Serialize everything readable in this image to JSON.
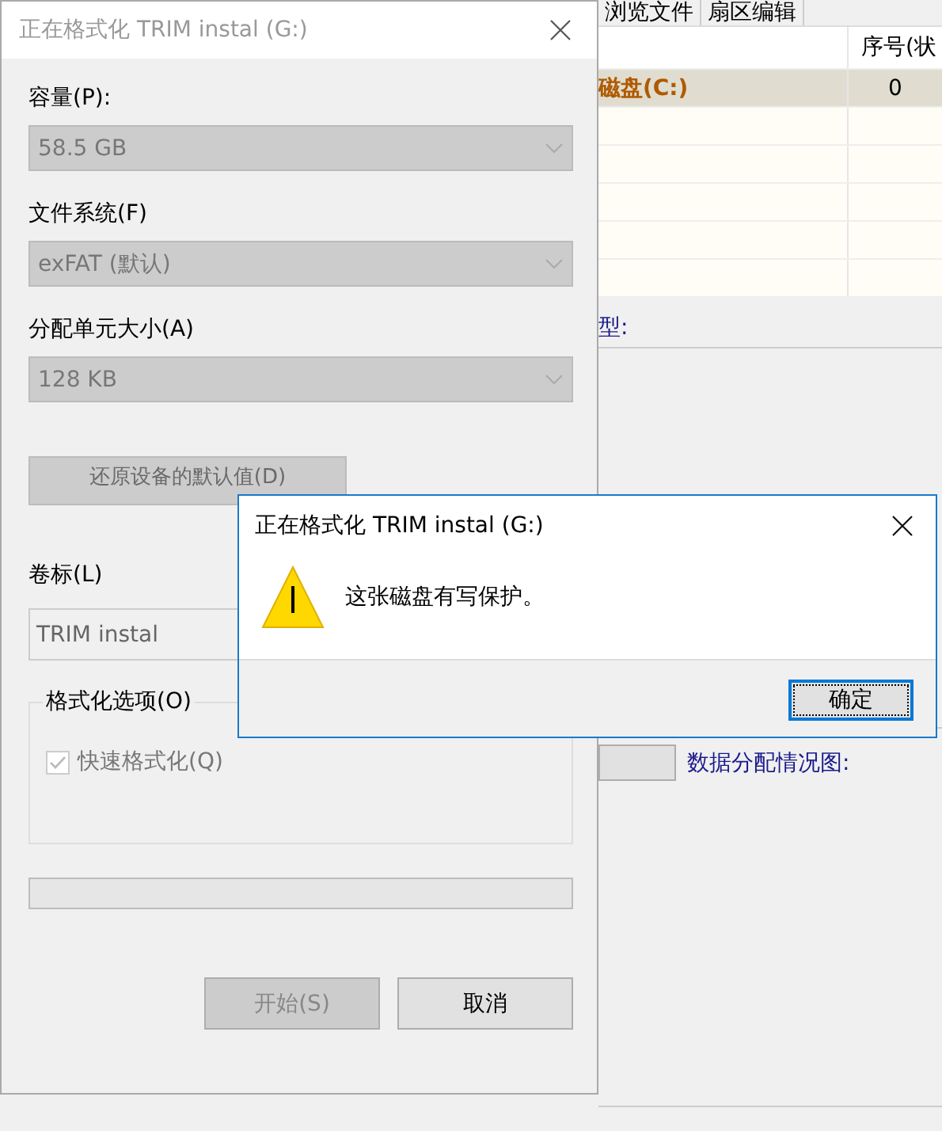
{
  "background_window": {
    "tabs": [
      {
        "label": "浏览文件",
        "selected": false
      },
      {
        "label": "扇区编辑",
        "selected": false
      }
    ],
    "table": {
      "column_2_header": "序号(状",
      "rows": [
        {
          "cells": [
            "磁盘(C:)",
            "0"
          ],
          "selected": true
        }
      ]
    },
    "type_label": "型:",
    "map_label": "数据分配情况图:"
  },
  "format_dialog": {
    "title": "正在格式化 TRIM instal (G:)",
    "active": false,
    "fields": [
      {
        "label": "容量(P):",
        "value": "58.5 GB",
        "disabled": true
      },
      {
        "label": "文件系统(F)",
        "value": "exFAT (默认)",
        "disabled": true
      },
      {
        "label": "分配单元大小(A)",
        "value": "128 KB",
        "disabled": true
      }
    ],
    "restore_button": {
      "label": "还原设备的默认值(D)",
      "disabled": true
    },
    "volume_label": {
      "label": "卷标(L)",
      "value": "TRIM instal"
    },
    "options": {
      "title": "格式化选项(O)",
      "checkboxes": [
        {
          "label": "快速格式化(Q)",
          "checked": true,
          "disabled": true
        }
      ]
    },
    "progress": {
      "level": 0
    },
    "buttons": [
      {
        "label": "开始(S)",
        "disabled": true
      },
      {
        "label": "取消",
        "disabled": false
      }
    ]
  },
  "message_box": {
    "title": "正在格式化 TRIM instal (G:)",
    "message": "这张磁盘有写保护。",
    "buttons": [
      {
        "label": "确定",
        "focused": true
      }
    ]
  }
}
